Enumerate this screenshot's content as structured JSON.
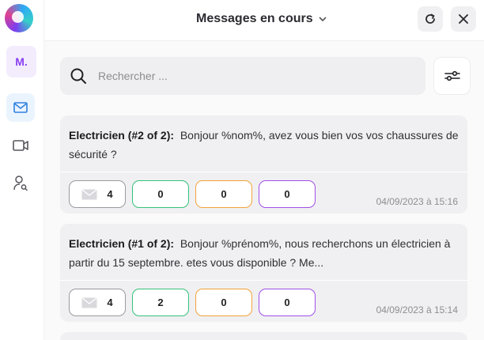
{
  "app": {
    "user_initials": "M.",
    "brand_color": "#8a3ff0",
    "accent_color": "#2f7fe0"
  },
  "sidebar": {
    "items": [
      {
        "name": "mail",
        "icon": "mail-icon",
        "active": true
      },
      {
        "name": "video",
        "icon": "video-icon",
        "active": false
      },
      {
        "name": "contacts",
        "icon": "user-search-icon",
        "active": false
      }
    ]
  },
  "header": {
    "title": "Messages en cours",
    "dropdown_icon": "chevron-down-icon",
    "refresh_icon": "refresh-icon",
    "close_icon": "close-icon"
  },
  "search": {
    "placeholder": "Rechercher ...",
    "value": "",
    "filter_icon": "sliders-icon"
  },
  "messages": [
    {
      "title": "Electricien (#2 of 2):",
      "body": "Bonjour %nom%, avez vous bien vos vos chaussures de sécurité ?",
      "sent": "4",
      "green": "0",
      "orange": "0",
      "purple": "0",
      "date": "04/09/2023 à 15:16"
    },
    {
      "title": "Electricien (#1 of 2):",
      "body": "Bonjour %prénom%, nous recherchons un électricien à partir du 15 septembre. etes vous disponible ? Me...",
      "sent": "4",
      "green": "2",
      "orange": "0",
      "purple": "0",
      "date": "04/09/2023 à 15:14"
    }
  ],
  "status_colors": {
    "green": "#35c27a",
    "orange": "#f2a23a",
    "purple": "#a050e6",
    "neutral": "#9a9aa0"
  }
}
